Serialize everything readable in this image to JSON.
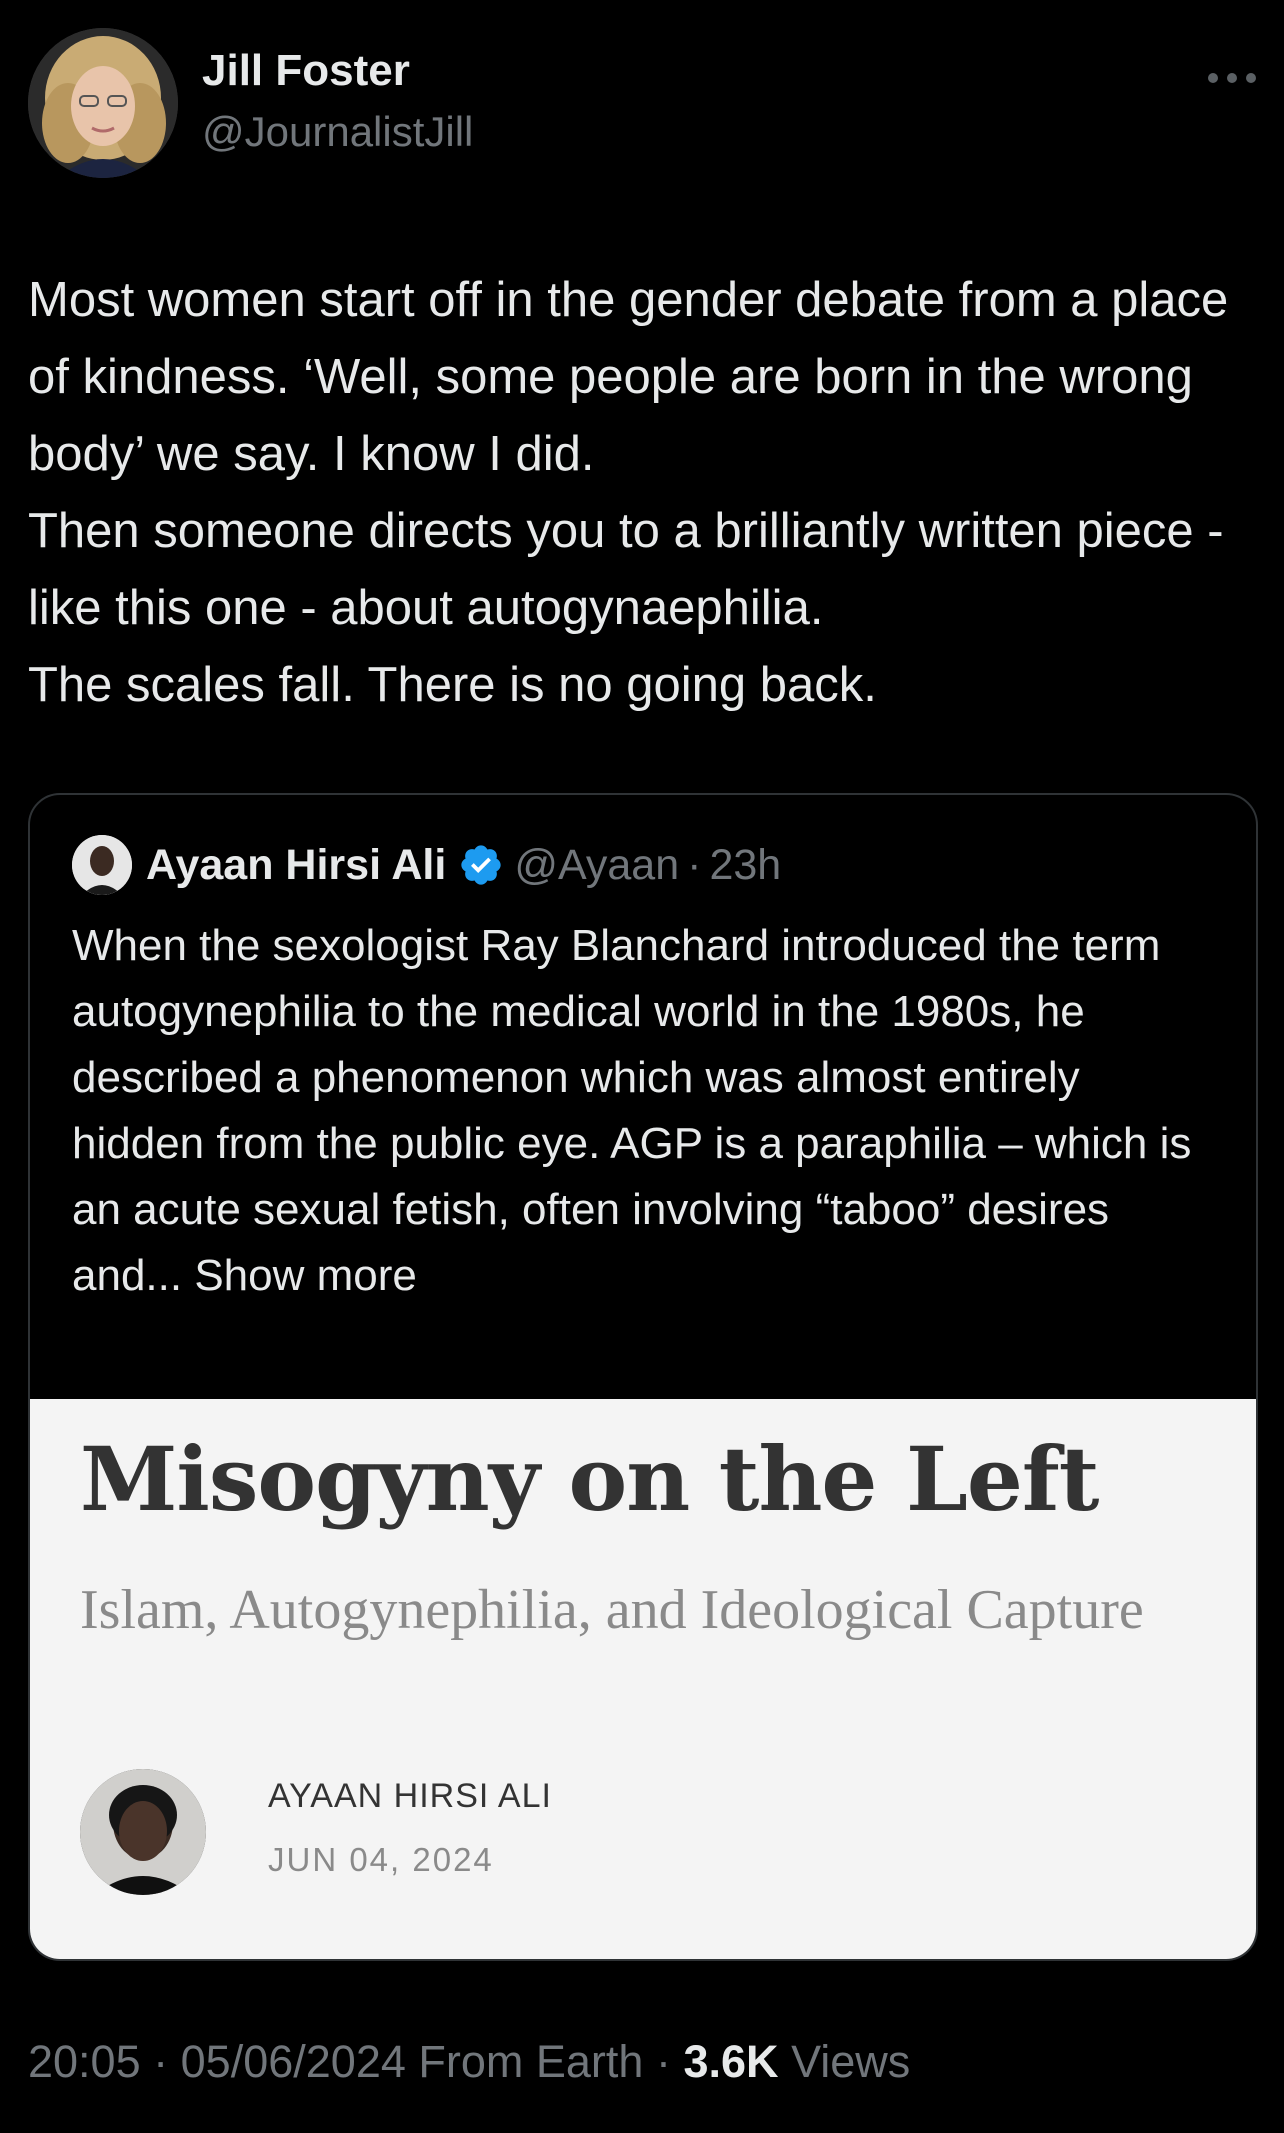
{
  "author": {
    "name": "Jill Foster",
    "handle": "@JournalistJill"
  },
  "tweet": {
    "lines": [
      "Most women start off in the gender debate from a place of kindness. ‘Well, some people are born in the wrong body’ we say. I know I did.",
      "Then someone directs you to a brilliantly written piece - like this one - about autogynaephilia.",
      "The scales fall. There is no going back."
    ]
  },
  "quote": {
    "name": "Ayaan Hirsi Ali",
    "handle": "@Ayaan",
    "separator": "·",
    "time": "23h",
    "text": "When the sexologist Ray Blanchard introduced the term autogynephilia to the medical world in the 1980s, he described a phenomenon which was almost entirely hidden from the public eye. AGP is a paraphilia – which is an acute sexual fetish, often involving “taboo” desires and...",
    "show_more": "Show more",
    "verified_color": "#1d9bf0"
  },
  "article": {
    "title": "Misogyny on the Left",
    "subtitle": "Islam, Autogynephilia, and Ideological Capture",
    "author": "AYAAN HIRSI ALI",
    "date": "JUN 04, 2024"
  },
  "footer": {
    "time": "20:05",
    "sep1": "·",
    "date": "05/06/2024",
    "source": "From Earth",
    "sep2": "·",
    "views_count": "3.6K",
    "views_label": "Views"
  }
}
